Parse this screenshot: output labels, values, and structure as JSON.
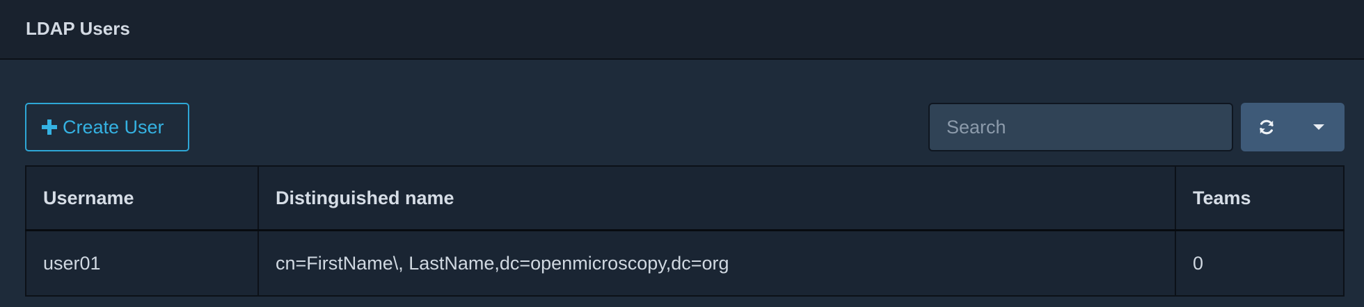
{
  "header": {
    "title": "LDAP Users"
  },
  "toolbar": {
    "create_label": "Create User",
    "search_placeholder": "Search",
    "search_value": "",
    "refresh_icon": "refresh-icon",
    "dropdown_icon": "caret-down-icon"
  },
  "table": {
    "columns": [
      "Username",
      "Distinguished name",
      "Teams"
    ],
    "rows": [
      {
        "username": "user01",
        "dn": "cn=FirstName\\, LastName,dc=openmicroscopy,dc=org",
        "teams": "0"
      }
    ]
  },
  "colors": {
    "accent": "#35b2e2",
    "header_bg": "#19222e",
    "page_bg": "#1e2b3a",
    "button_group_bg": "#3e5a78"
  }
}
